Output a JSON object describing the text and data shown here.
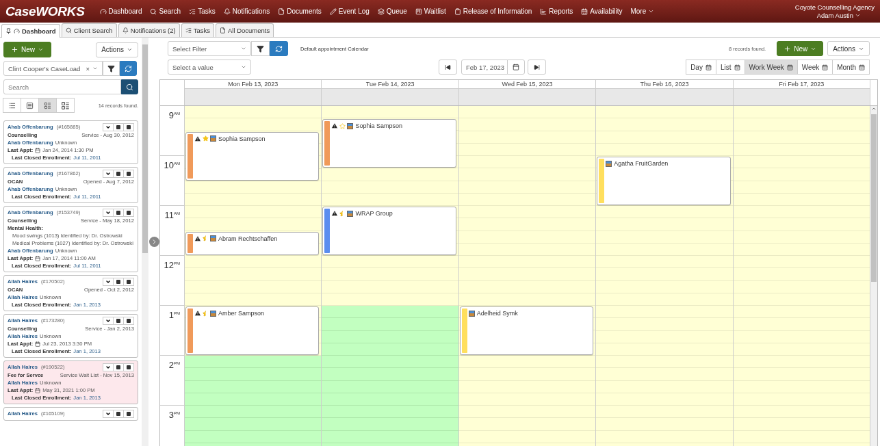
{
  "app": {
    "logo": "CaseWORKS",
    "agency": "Coyote Counselling Agency",
    "user": "Adam Austin"
  },
  "nav": [
    {
      "label": "Dashboard"
    },
    {
      "label": "Search"
    },
    {
      "label": "Tasks"
    },
    {
      "label": "Notifications"
    },
    {
      "label": "Documents"
    },
    {
      "label": "Event Log"
    },
    {
      "label": "Queue"
    },
    {
      "label": "Waitlist"
    },
    {
      "label": "Release of Information"
    },
    {
      "label": "Reports"
    },
    {
      "label": "Availability"
    },
    {
      "label": "More"
    }
  ],
  "tabs": [
    {
      "label": "Dashboard",
      "selected": true
    },
    {
      "label": "Client Search",
      "selected": false
    },
    {
      "label": "Notifications (2)",
      "selected": false
    },
    {
      "label": "Tasks",
      "selected": false
    },
    {
      "label": "All Documents",
      "selected": false
    }
  ],
  "sidebar": {
    "new_button": "New",
    "actions_button": "Actions",
    "caseload": "Clint Cooper's CaseLoad",
    "clear": "×",
    "search_placeholder": "Search",
    "records_found": "14 records found.",
    "density": [
      {
        "selected": false
      },
      {
        "selected": false
      },
      {
        "selected": true
      },
      {
        "selected": false
      }
    ],
    "cards": [
      {
        "name": "Ahab Offenbarung",
        "id": "(#165885)",
        "highlighted": false,
        "program": "Counselling",
        "status": "Service - Aug 30, 2012",
        "client": "Ahab Offenbarung",
        "client_status": "Unknown",
        "last_appt_label": "Last Appt:",
        "last_appt": "Jan 24, 2014 1:30 PM",
        "closed_label": "Last Closed Enrollment:",
        "closed": "Jul 11, 2011"
      },
      {
        "name": "Ahab Offenbarung",
        "id": "(#167862)",
        "highlighted": false,
        "program": "OCAN",
        "status": "Opened - Aug 7, 2012",
        "client": "Ahab Offenbarung",
        "client_status": "Unknown",
        "closed_label": "Last Closed Enrollment:",
        "closed": "Jul 11, 2011"
      },
      {
        "name": "Ahab Offenbarung",
        "id": "(#153749)",
        "highlighted": false,
        "program": "Counselling",
        "status": "Service - May 18, 2012",
        "health_label": "Mental Health:",
        "health": [
          "Mood swings (1013) Identified by: Dr. Ostrowski",
          "Medical Problems (1027) Identified by: Dr. Ostrowski"
        ],
        "client": "Ahab Offenbarung",
        "client_status": "Unknown",
        "last_appt_label": "Last Appt:",
        "last_appt": "Jan 17, 2014 11:00 AM",
        "closed_label": "Last Closed Enrollment:",
        "closed": "Jul 11, 2011"
      },
      {
        "name": "Allah Haires",
        "id": "(#170502)",
        "highlighted": false,
        "program": "OCAN",
        "status": "Opened - Oct 2, 2012",
        "client": "Allah Haires",
        "client_status": "Unknown",
        "closed_label": "Last Closed Enrollment:",
        "closed": "Jan 1, 2013"
      },
      {
        "name": "Allah Haires",
        "id": "(#173280)",
        "highlighted": false,
        "program": "Counselling",
        "status": "Service - Jan 2, 2013",
        "client": "Allah Haires",
        "client_status": "Unknown",
        "last_appt_label": "Last Appt:",
        "last_appt": "Jul 23, 2013 3:30 PM",
        "closed_label": "Last Closed Enrollment:",
        "closed": "Jan 1, 2013"
      },
      {
        "name": "Allah Haires",
        "id": "(#190522)",
        "highlighted": true,
        "program": "Fee for Servce",
        "status": "Service Wait List - Nov 15, 2013",
        "client": "Allah Haires",
        "client_status": "Unknown",
        "last_appt_label": "Last Appt:",
        "last_appt": "May 31, 2021 1:00 PM",
        "closed_label": "Last Closed Enrollment:",
        "closed": "Jan 1, 2013"
      },
      {
        "name": "Allah Haires",
        "id": "(#165109)",
        "highlighted": false
      }
    ]
  },
  "calendar": {
    "filter_placeholder": "Select Filter",
    "caption": "Default appointment Calendar",
    "records_found": "8 records found.",
    "new_button": "New",
    "actions_button": "Actions",
    "value_placeholder": "Select a value",
    "date": "Feb 17, 2023",
    "views": [
      {
        "label": "Day",
        "selected": false
      },
      {
        "label": "List",
        "selected": false
      },
      {
        "label": "Work Week",
        "selected": true
      },
      {
        "label": "Week",
        "selected": false
      },
      {
        "label": "Month",
        "selected": false
      }
    ],
    "hours": [
      {
        "hour": "9",
        "period": "AM"
      },
      {
        "hour": "10",
        "period": "AM"
      },
      {
        "hour": "11",
        "period": "AM"
      },
      {
        "hour": "12",
        "period": "PM"
      },
      {
        "hour": "1",
        "period": "PM"
      },
      {
        "hour": "2",
        "period": "PM"
      },
      {
        "hour": "3",
        "period": "PM"
      }
    ],
    "days": [
      {
        "label": "Mon Feb 13, 2023",
        "slots": [
          {
            "kind": "free"
          },
          {
            "kind": "free"
          },
          {
            "kind": "event",
            "name": "Sophia Sampson",
            "color": "#f09a5a",
            "icons": [
              {
                "kind": "alert"
              },
              {
                "kind": "star"
              },
              {
                "kind": "photo"
              }
            ]
          },
          {
            "kind": "busy"
          },
          {
            "kind": "busy"
          },
          {
            "kind": "busy"
          },
          {
            "kind": "free"
          },
          {
            "kind": "free"
          },
          {
            "kind": "free"
          },
          {
            "kind": "free"
          },
          {
            "kind": "event",
            "name": "Abram Rechtschaffen",
            "color": "#f09a5a",
            "icons": [
              {
                "kind": "alert"
              },
              {
                "kind": "half-star"
              },
              {
                "kind": "photo"
              }
            ]
          },
          {
            "kind": "busy"
          },
          {
            "kind": "free"
          },
          {
            "kind": "free"
          },
          {
            "kind": "free"
          },
          {
            "kind": "free"
          },
          {
            "kind": "event",
            "name": "Amber Sampson",
            "color": "#f09a5a",
            "icons": [
              {
                "kind": "alert"
              },
              {
                "kind": "half-star"
              },
              {
                "kind": "photo"
              }
            ]
          },
          {
            "kind": "busy"
          },
          {
            "kind": "busy"
          },
          {
            "kind": "busy"
          },
          {
            "kind": "open"
          },
          {
            "kind": "open"
          },
          {
            "kind": "open"
          },
          {
            "kind": "open"
          },
          {
            "kind": "open"
          },
          {
            "kind": "open"
          },
          {
            "kind": "open"
          },
          {
            "kind": "open"
          }
        ]
      },
      {
        "label": "Tue Feb 14, 2023",
        "slots": [
          {
            "kind": "free"
          },
          {
            "kind": "event",
            "name": "Sophia Sampson",
            "color": "#f09a5a",
            "icons": [
              {
                "kind": "alert"
              },
              {
                "kind": "star-outline"
              },
              {
                "kind": "photo"
              }
            ]
          },
          {
            "kind": "busy"
          },
          {
            "kind": "busy"
          },
          {
            "kind": "busy"
          },
          {
            "kind": "free"
          },
          {
            "kind": "free"
          },
          {
            "kind": "free"
          },
          {
            "kind": "event",
            "name": "WRAP Group",
            "color": "#5b8def",
            "icons": [
              {
                "kind": "alert"
              },
              {
                "kind": "half-star"
              },
              {
                "kind": "photo"
              }
            ]
          },
          {
            "kind": "busy"
          },
          {
            "kind": "busy"
          },
          {
            "kind": "busy"
          },
          {
            "kind": "free"
          },
          {
            "kind": "free"
          },
          {
            "kind": "free"
          },
          {
            "kind": "free"
          },
          {
            "kind": "open"
          },
          {
            "kind": "open"
          },
          {
            "kind": "open"
          },
          {
            "kind": "open"
          },
          {
            "kind": "open"
          },
          {
            "kind": "open"
          },
          {
            "kind": "open"
          },
          {
            "kind": "open"
          },
          {
            "kind": "open"
          },
          {
            "kind": "open"
          },
          {
            "kind": "open"
          },
          {
            "kind": "open"
          }
        ]
      },
      {
        "label": "Wed Feb 15, 2023",
        "slots": [
          {
            "kind": "free"
          },
          {
            "kind": "free"
          },
          {
            "kind": "free"
          },
          {
            "kind": "free"
          },
          {
            "kind": "free"
          },
          {
            "kind": "free"
          },
          {
            "kind": "free"
          },
          {
            "kind": "free"
          },
          {
            "kind": "free"
          },
          {
            "kind": "free"
          },
          {
            "kind": "free"
          },
          {
            "kind": "free"
          },
          {
            "kind": "free"
          },
          {
            "kind": "free"
          },
          {
            "kind": "free"
          },
          {
            "kind": "free"
          },
          {
            "kind": "event",
            "name": "Adelheid Symk",
            "color": "#ffdf5e",
            "icons": [
              {
                "kind": "photo"
              }
            ]
          },
          {
            "kind": "busy"
          },
          {
            "kind": "busy"
          },
          {
            "kind": "busy"
          },
          {
            "kind": "free"
          },
          {
            "kind": "free"
          },
          {
            "kind": "free"
          },
          {
            "kind": "free"
          },
          {
            "kind": "free"
          },
          {
            "kind": "free"
          },
          {
            "kind": "free"
          },
          {
            "kind": "free"
          }
        ]
      },
      {
        "label": "Thu Feb 16, 2023",
        "slots": [
          {
            "kind": "free"
          },
          {
            "kind": "free"
          },
          {
            "kind": "free"
          },
          {
            "kind": "free"
          },
          {
            "kind": "event",
            "name": "Agatha FruitGarden",
            "color": "#ffdf5e",
            "icons": [
              {
                "kind": "photo"
              }
            ]
          },
          {
            "kind": "busy"
          },
          {
            "kind": "busy"
          },
          {
            "kind": "busy"
          },
          {
            "kind": "free"
          },
          {
            "kind": "free"
          },
          {
            "kind": "free"
          },
          {
            "kind": "free"
          },
          {
            "kind": "free"
          },
          {
            "kind": "free"
          },
          {
            "kind": "free"
          },
          {
            "kind": "free"
          },
          {
            "kind": "free"
          },
          {
            "kind": "free"
          },
          {
            "kind": "free"
          },
          {
            "kind": "free"
          },
          {
            "kind": "free"
          },
          {
            "kind": "free"
          },
          {
            "kind": "free"
          },
          {
            "kind": "free"
          },
          {
            "kind": "free"
          },
          {
            "kind": "free"
          },
          {
            "kind": "free"
          },
          {
            "kind": "free"
          }
        ]
      },
      {
        "label": "Fri Feb 17, 2023",
        "slots": [
          {
            "kind": "free"
          },
          {
            "kind": "free"
          },
          {
            "kind": "free"
          },
          {
            "kind": "free"
          },
          {
            "kind": "free"
          },
          {
            "kind": "free"
          },
          {
            "kind": "free"
          },
          {
            "kind": "free"
          },
          {
            "kind": "free"
          },
          {
            "kind": "free"
          },
          {
            "kind": "free"
          },
          {
            "kind": "free"
          },
          {
            "kind": "free"
          },
          {
            "kind": "free"
          },
          {
            "kind": "free"
          },
          {
            "kind": "free"
          },
          {
            "kind": "free"
          },
          {
            "kind": "free"
          },
          {
            "kind": "free"
          },
          {
            "kind": "free"
          },
          {
            "kind": "free"
          },
          {
            "kind": "free"
          },
          {
            "kind": "free"
          },
          {
            "kind": "free"
          },
          {
            "kind": "free"
          },
          {
            "kind": "free"
          },
          {
            "kind": "free"
          },
          {
            "kind": "free"
          }
        ]
      }
    ]
  }
}
